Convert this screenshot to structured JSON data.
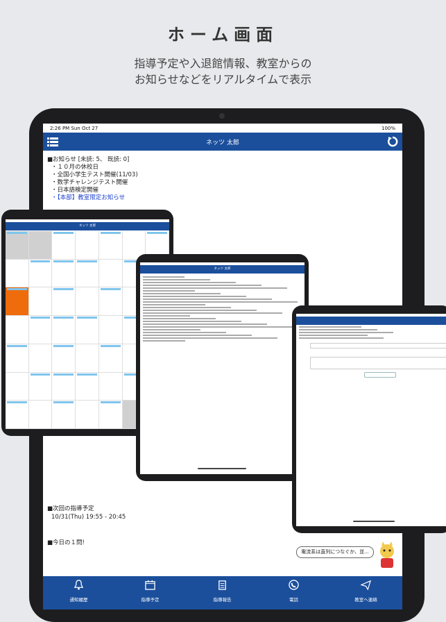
{
  "promo": {
    "title": "ホーム画面",
    "subtitle_line1": "指導予定や入退館情報、教室からの",
    "subtitle_line2": "お知らせなどをリアルタイムで表示"
  },
  "status": {
    "time": "2:26 PM   Sun Oct 27",
    "battery": "100%"
  },
  "navbar": {
    "title": "ネッツ 太郎",
    "menu_icon": "list-icon",
    "refresh_icon": "refresh-icon"
  },
  "notices": {
    "heading": "■お知らせ [未読: 5、 既読: 0]",
    "items": [
      "・１０月の休校日",
      "・全国小学生テスト開催(11/03)",
      "・数学チャレンジテスト開催",
      "・日本語検定開催"
    ],
    "link_item": "・【本部】教室限定お知らせ"
  },
  "next_lesson": {
    "heading": "■次回の指導予定",
    "time": "10/31(Thu) 19:55 - 20:45"
  },
  "today_quiz": {
    "heading": "■今日の１問!"
  },
  "bubble": {
    "text": "電流系は直列につなぐか、並..."
  },
  "tabs": [
    {
      "label": "通知履歴",
      "icon": "bell-icon"
    },
    {
      "label": "指導予定",
      "icon": "calendar-icon"
    },
    {
      "label": "指導報告",
      "icon": "report-icon"
    },
    {
      "label": "電話",
      "icon": "phone-icon"
    },
    {
      "label": "教室へ連絡",
      "icon": "send-icon"
    }
  ],
  "mini": {
    "nav_title": "ネッツ 太郎"
  },
  "colors": {
    "nav": "#1b4f9c",
    "event": "#7fc5ee",
    "highlight": "#ef6c0c",
    "link": "#1a3fd0"
  }
}
